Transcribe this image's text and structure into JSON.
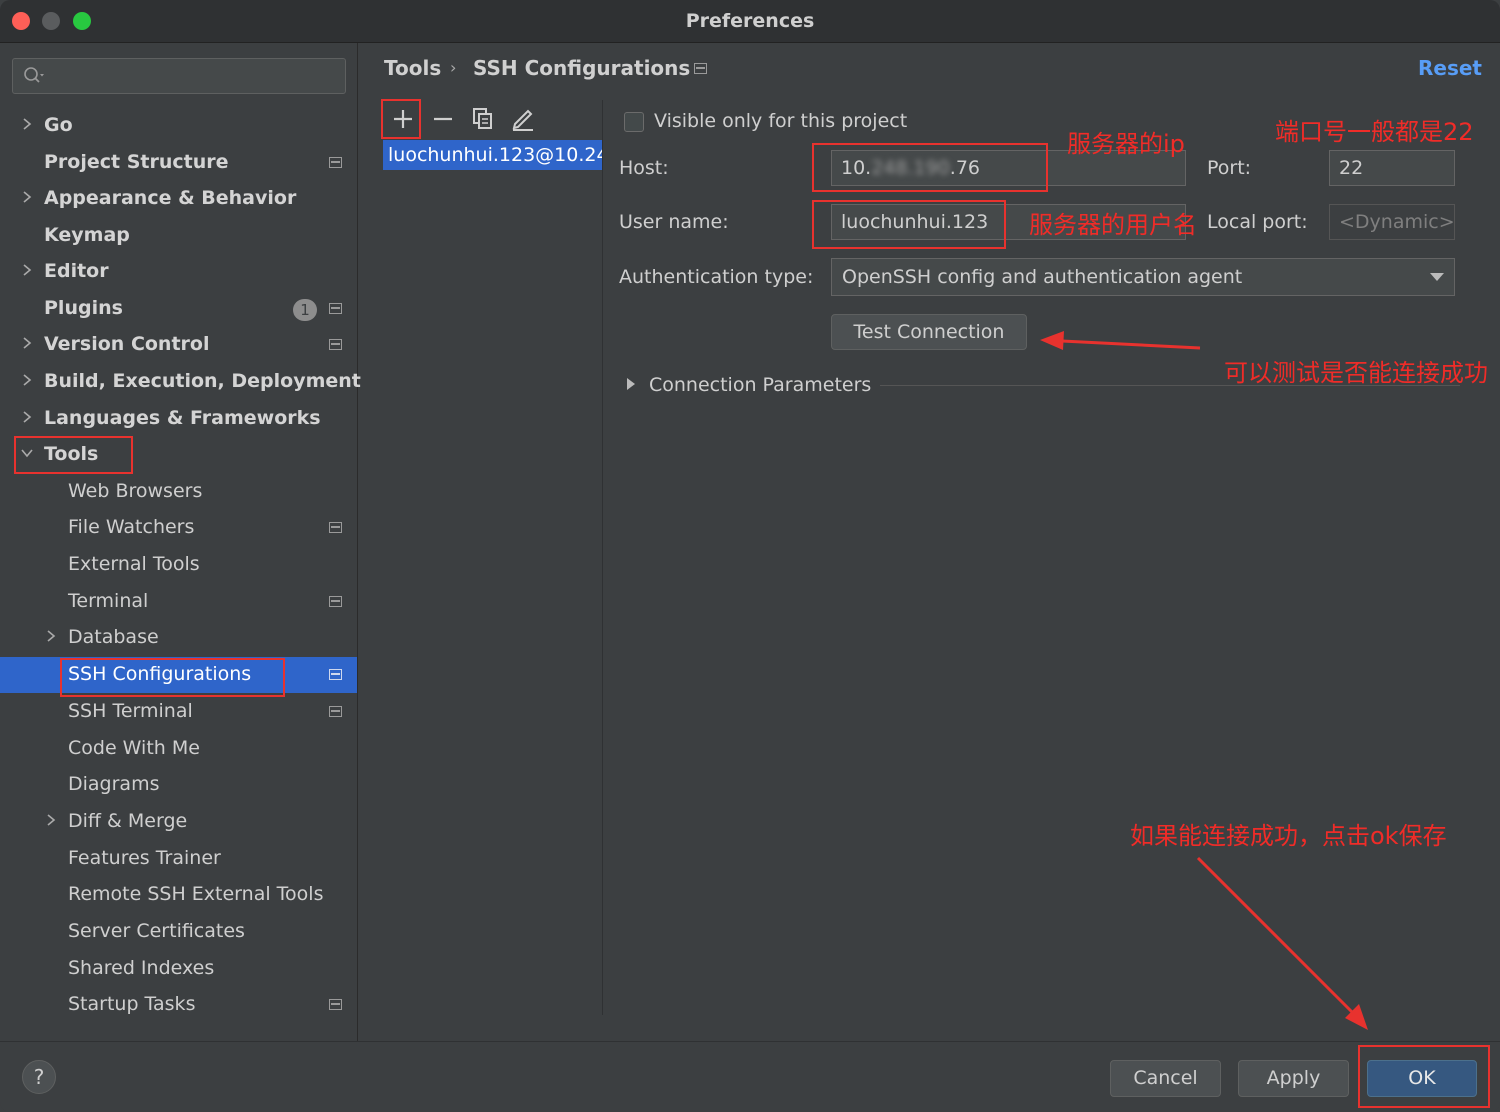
{
  "window": {
    "title": "Preferences"
  },
  "search": {
    "placeholder": ""
  },
  "sidebar": {
    "items": [
      {
        "label": "Go"
      },
      {
        "label": "Project Structure"
      },
      {
        "label": "Appearance & Behavior"
      },
      {
        "label": "Keymap"
      },
      {
        "label": "Editor"
      },
      {
        "label": "Plugins",
        "badge": "1"
      },
      {
        "label": "Version Control"
      },
      {
        "label": "Build, Execution, Deployment"
      },
      {
        "label": "Languages & Frameworks"
      },
      {
        "label": "Tools"
      },
      {
        "label": "Web Browsers"
      },
      {
        "label": "File Watchers"
      },
      {
        "label": "External Tools"
      },
      {
        "label": "Terminal"
      },
      {
        "label": "Database"
      },
      {
        "label": "SSH Configurations"
      },
      {
        "label": "SSH Terminal"
      },
      {
        "label": "Code With Me"
      },
      {
        "label": "Diagrams"
      },
      {
        "label": "Diff & Merge"
      },
      {
        "label": "Features Trainer"
      },
      {
        "label": "Remote SSH External Tools"
      },
      {
        "label": "Server Certificates"
      },
      {
        "label": "Shared Indexes"
      },
      {
        "label": "Startup Tasks"
      }
    ]
  },
  "header": {
    "breadcrumb": [
      "Tools",
      "SSH Configurations"
    ],
    "reset_label": "Reset"
  },
  "config_list": {
    "items": [
      "luochunhui.123@10.24"
    ]
  },
  "form": {
    "visible_only_label": "Visible only for this project",
    "host_label": "Host:",
    "host_prefix": "10.",
    "host_masked": "248.190",
    "host_suffix": ".76",
    "port_label": "Port:",
    "port_value": "22",
    "username_label": "User name:",
    "username_value": "luochunhui.123",
    "local_port_label": "Local port:",
    "local_port_placeholder": "<Dynamic>",
    "auth_label": "Authentication type:",
    "auth_value": "OpenSSH config and authentication agent",
    "test_connection_label": "Test Connection",
    "connection_params_label": "Connection Parameters"
  },
  "footer": {
    "help_label": "?",
    "cancel_label": "Cancel",
    "apply_label": "Apply",
    "ok_label": "OK"
  },
  "annotations": {
    "server_ip": "服务器的ip",
    "port_note": "端口号一般都是22",
    "server_user": "服务器的用户名",
    "test_note": "可以测试是否能连接成功",
    "ok_note": "如果能连接成功，点击ok保存",
    "color": "#f02c28"
  }
}
